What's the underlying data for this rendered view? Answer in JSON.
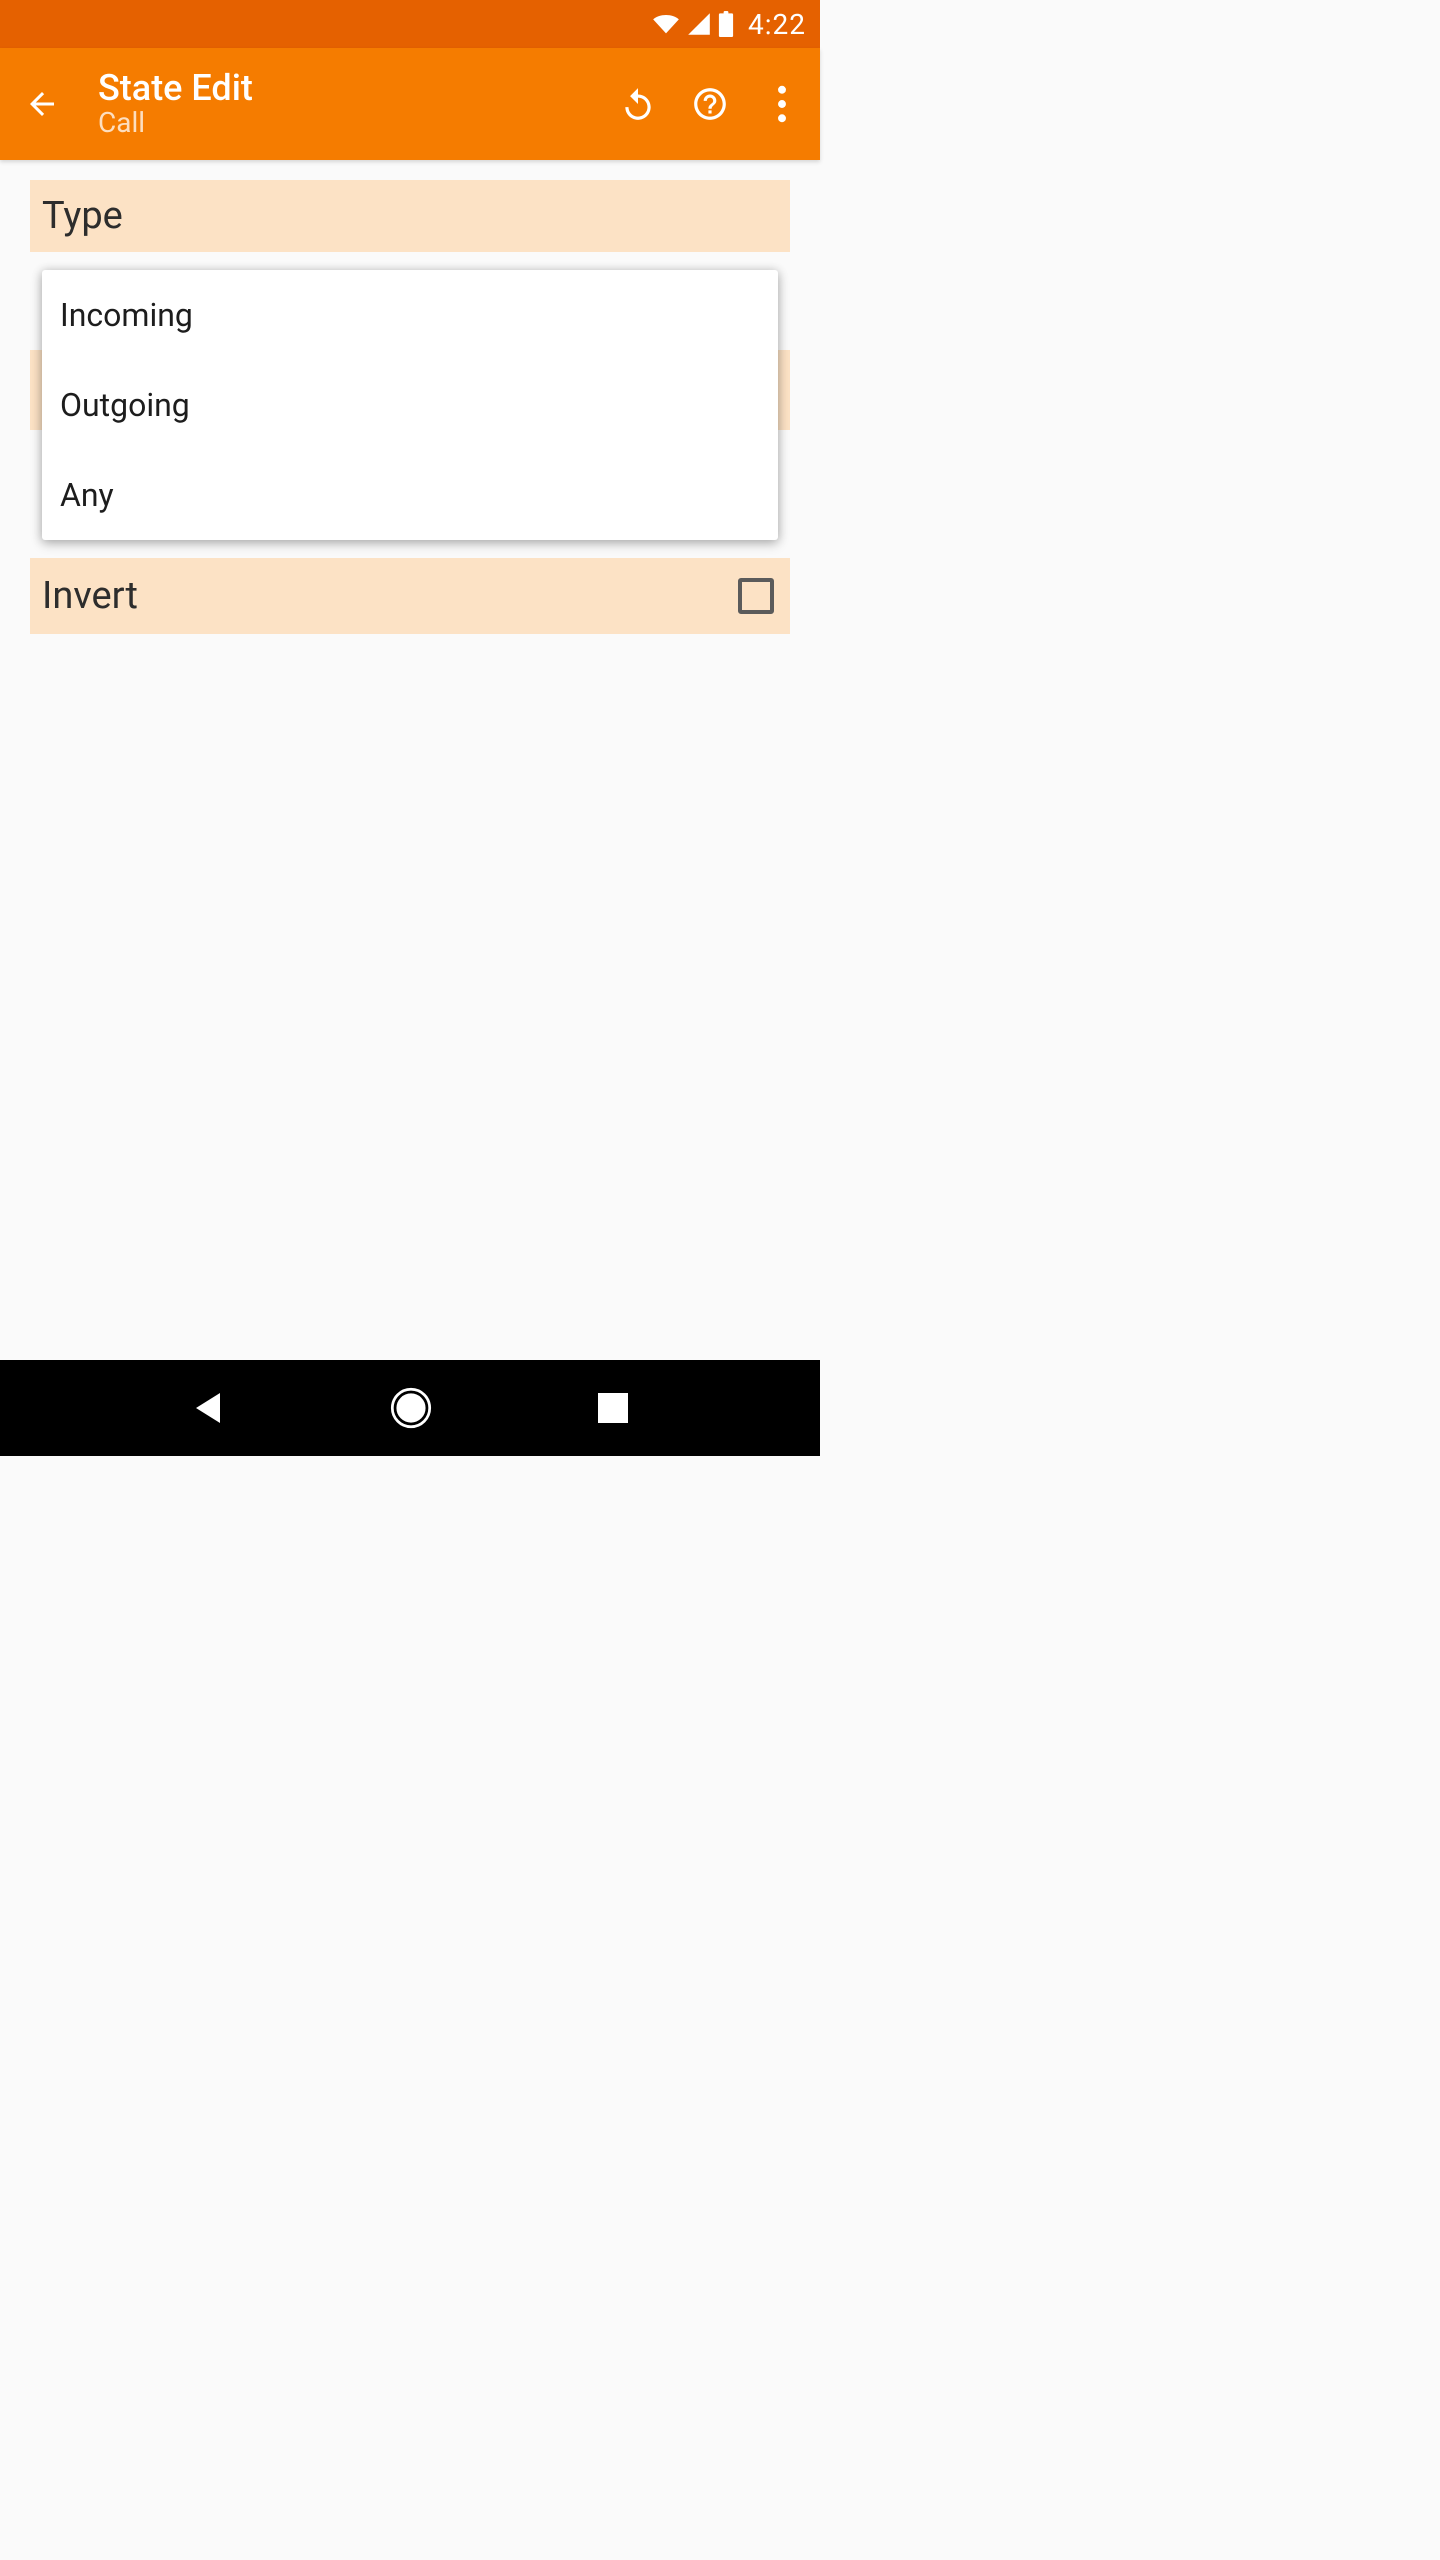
{
  "status_bar": {
    "time": "4:22"
  },
  "action_bar": {
    "title": "State Edit",
    "subtitle": "Call"
  },
  "sections": {
    "type_label": "Type",
    "invert_label": "Invert"
  },
  "dropdown": {
    "options": [
      "Incoming",
      "Outgoing",
      "Any"
    ]
  }
}
